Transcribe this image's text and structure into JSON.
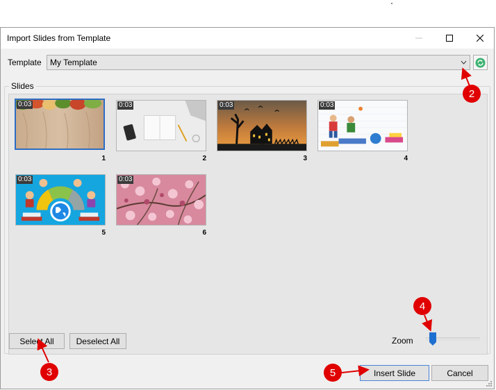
{
  "window": {
    "title": "Import Slides from Template"
  },
  "template": {
    "label": "Template",
    "value": "My Template"
  },
  "slides": {
    "label": "Slides",
    "items": [
      {
        "duration": "0:03",
        "number": "1"
      },
      {
        "duration": "0:03",
        "number": "2"
      },
      {
        "duration": "0:03",
        "number": "3"
      },
      {
        "duration": "0:03",
        "number": "4"
      },
      {
        "duration": "0:03",
        "number": "5"
      },
      {
        "duration": "0:03",
        "number": "6"
      }
    ]
  },
  "buttons": {
    "select_all": "Select All",
    "deselect_all": "Deselect All",
    "insert_slide": "Insert Slide",
    "cancel": "Cancel"
  },
  "zoom": {
    "label": "Zoom",
    "level": 0.1
  },
  "callouts": [
    "2",
    "3",
    "4",
    "5"
  ],
  "colors": {
    "accent": "#2b6cc4",
    "callout": "#e00000",
    "refresh": "#3cb371"
  }
}
